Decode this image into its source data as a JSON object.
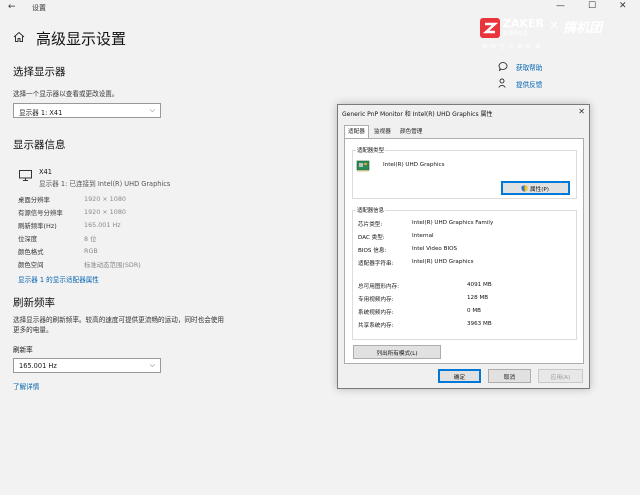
{
  "window": {
    "title": "设置",
    "back": "←",
    "minimize": "—",
    "maximize": "☐",
    "close": "✕"
  },
  "page": {
    "title": "高级显示设置"
  },
  "select_display": {
    "heading": "选择显示器",
    "label": "选择一个显示器以查看或更改设置。",
    "selected": "显示器 1: X41"
  },
  "display_info": {
    "heading": "显示器信息",
    "monitor_name": "X41",
    "monitor_sub": "显示器 1: 已连接到 Intel(R) UHD Graphics",
    "rows": [
      {
        "k": "桌面分辨率",
        "v": "1920 × 1080"
      },
      {
        "k": "有源信号分辨率",
        "v": "1920 × 1080"
      },
      {
        "k": "刷新频率(Hz)",
        "v": "165.001 Hz"
      },
      {
        "k": "位深度",
        "v": "8 位"
      },
      {
        "k": "颜色格式",
        "v": "RGB"
      },
      {
        "k": "颜色空间",
        "v": "标准动态范围(SDR)"
      }
    ],
    "adapter_link": "显示器 1 的显示适配器属性"
  },
  "refresh": {
    "heading": "刷新频率",
    "desc_line1": "选择显示器的刷新频率。较高的速度可提供更流畅的运动，同时也会使用",
    "desc_line2": "更多的电量。",
    "label": "刷新率",
    "selected": "165.001 Hz",
    "more_link": "了解详情"
  },
  "help": {
    "get_help": "获取帮助",
    "feedback": "提供反馈"
  },
  "watermark": {
    "brand": "ZAKER",
    "sub": "新视线信息",
    "times": "×",
    "brand2": "搞机团",
    "tagline": "科 技 生 活 新 鲜 事"
  },
  "dialog": {
    "title": "Generic PnP Monitor 和 Intel(R) UHD Graphics 属性",
    "close": "✕",
    "tabs": [
      "适配器",
      "监视器",
      "颜色管理"
    ],
    "adapter_type_label": "适配器类型",
    "adapter_name": "Intel(R) UHD Graphics",
    "properties_button": "属性(P)",
    "adapter_info_label": "适配器信息",
    "info": [
      {
        "k": "芯片类型:",
        "v": "Intel(R) UHD Graphics Family"
      },
      {
        "k": "DAC 类型:",
        "v": "Internal"
      },
      {
        "k": "BIOS 信息:",
        "v": "Intel Video BIOS"
      },
      {
        "k": "适配器字符串:",
        "v": "Intel(R) UHD Graphics"
      }
    ],
    "memory": [
      {
        "k": "总可用图形内存:",
        "v": "4091 MB"
      },
      {
        "k": "专用视频内存:",
        "v": "128 MB"
      },
      {
        "k": "系统视频内存:",
        "v": "0 MB"
      },
      {
        "k": "共享系统内存:",
        "v": "3963 MB"
      }
    ],
    "list_modes_button": "列出所有模式(L)",
    "ok": "确定",
    "cancel": "取消",
    "apply": "应用(A)"
  }
}
